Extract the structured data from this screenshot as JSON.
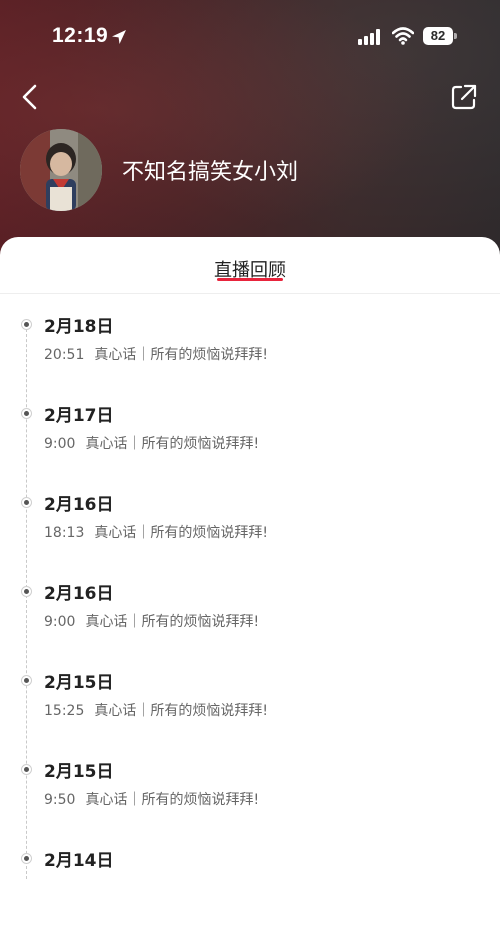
{
  "status_bar": {
    "time": "12:19",
    "battery": "82"
  },
  "profile": {
    "name": "不知名搞笑女小刘"
  },
  "tabs": [
    {
      "label": "直播回顾",
      "active": true
    }
  ],
  "colors": {
    "accent": "#e8243c",
    "header_bg": "#4a2326"
  },
  "entries": [
    {
      "date": "2月18日",
      "time": "20:51",
      "title": "真心话｜所有的烦恼说拜拜!"
    },
    {
      "date": "2月17日",
      "time": "9:00",
      "title": "真心话｜所有的烦恼说拜拜!"
    },
    {
      "date": "2月16日",
      "time": "18:13",
      "title": "真心话｜所有的烦恼说拜拜!"
    },
    {
      "date": "2月16日",
      "time": "9:00",
      "title": "真心话｜所有的烦恼说拜拜!"
    },
    {
      "date": "2月15日",
      "time": "15:25",
      "title": "真心话｜所有的烦恼说拜拜!"
    },
    {
      "date": "2月15日",
      "time": "9:50",
      "title": "真心话｜所有的烦恼说拜拜!"
    },
    {
      "date": "2月14日",
      "time": "",
      "title": ""
    }
  ],
  "icons": {
    "back": "chevron-left-icon",
    "share": "share-icon",
    "location": "location-arrow-icon",
    "signal": "cellular-signal-icon",
    "wifi": "wifi-icon"
  }
}
